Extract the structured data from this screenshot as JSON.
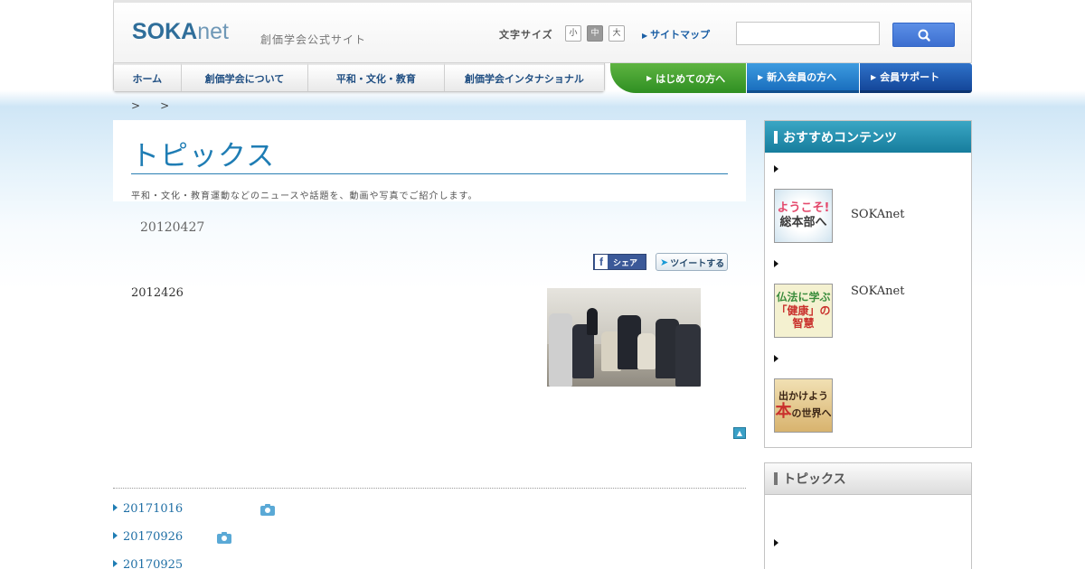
{
  "header": {
    "logo_main": "SOKA",
    "logo_sub": "net",
    "tagline": "創価学会公式サイト",
    "font_size_label": "文字サイズ",
    "font_sizes": [
      "小",
      "中",
      "大"
    ],
    "font_size_selected": "中",
    "sitemap": "サイトマップ",
    "search_icon": "search-icon"
  },
  "nav": {
    "items": [
      "ホーム",
      "創価学会について",
      "平和・文化・教育",
      "創価学会インタナショナル"
    ],
    "cta_first": "はじめての方へ",
    "cta_new": "新入会員の方へ",
    "cta_support": "会員サポート"
  },
  "breadcrumb": [
    ">",
    ">"
  ],
  "main": {
    "title": "トピックス",
    "lead": "平和・文化・教育運動などのニュースや話題を、動画や写真でご紹介します。",
    "date": "20120427",
    "share_label": "シェア",
    "tweet_label": "ツイートする",
    "body": "2012426"
  },
  "topics_list": [
    {
      "date": "20171016"
    },
    {
      "date": "20170926"
    },
    {
      "date": "20170925"
    }
  ],
  "sidebar": {
    "recommend_title": "おすすめコンテンツ",
    "items": [
      {
        "thumb_line1": "ようこそ!",
        "thumb_line2": "総本部へ",
        "label": "SOKAnet"
      },
      {
        "thumb_line1": "仏法に学ぶ",
        "thumb_line2": "「健康」の智慧",
        "label": "SOKAnet"
      },
      {
        "thumb_line1": "出かけよう",
        "thumb_line2": "本",
        "thumb_line3": "の世界へ",
        "label": ""
      }
    ],
    "topics_title": "トピックス"
  },
  "colors": {
    "accent": "#1f7db4",
    "nav_text": "#1f4e82",
    "cta_green": "#2f8f22",
    "cta_blue": "#1a6fbe"
  }
}
